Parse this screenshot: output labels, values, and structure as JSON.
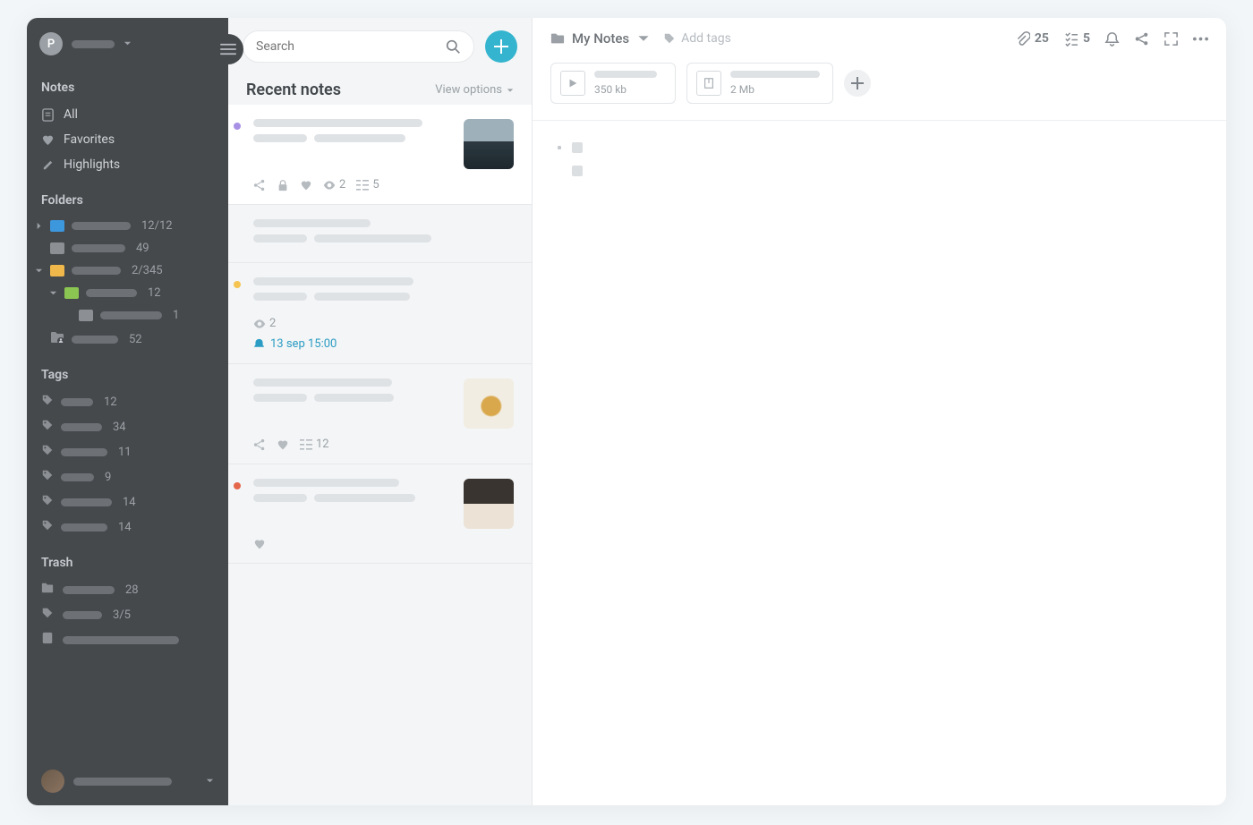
{
  "sidebar": {
    "avatar_initial": "P",
    "sections": {
      "notes_title": "Notes",
      "folders_title": "Folders",
      "tags_title": "Tags",
      "trash_title": "Trash"
    },
    "notes_nav": [
      {
        "icon": "note",
        "label": "All"
      },
      {
        "icon": "heart",
        "label": "Favorites"
      },
      {
        "icon": "pen",
        "label": "Highlights"
      }
    ],
    "folders": [
      {
        "level": 0,
        "expand": "right",
        "color": "blue",
        "count": "12/12"
      },
      {
        "level": 0,
        "expand": "none",
        "color": "grey",
        "count": "49"
      },
      {
        "level": 0,
        "expand": "down",
        "color": "yellow",
        "count": "2/345"
      },
      {
        "level": 1,
        "expand": "down",
        "color": "green",
        "count": "12"
      },
      {
        "level": 2,
        "expand": "none",
        "color": "grey",
        "count": "1"
      },
      {
        "level": 0,
        "expand": "none",
        "color": "shared",
        "count": "52"
      }
    ],
    "tags": [
      {
        "count": "12"
      },
      {
        "count": "34"
      },
      {
        "count": "11"
      },
      {
        "count": "9"
      },
      {
        "count": "14"
      },
      {
        "count": "14"
      }
    ],
    "trash": [
      {
        "icon": "folder",
        "count": "28"
      },
      {
        "icon": "tag",
        "count": "3/5"
      },
      {
        "icon": "note",
        "count": ""
      }
    ]
  },
  "mid": {
    "search_placeholder": "Search",
    "title": "Recent notes",
    "view_options": "View options",
    "notes": [
      {
        "dot": "#a891e5",
        "thumb": "sea",
        "icons": {
          "share": true,
          "lock": true,
          "heart": true,
          "views": "2",
          "tasks": "5"
        }
      },
      {
        "dot": null,
        "thumb": null,
        "icons": {}
      },
      {
        "dot": "#f5c451",
        "thumb": null,
        "icons": {
          "views": "2"
        },
        "reminder": "13 sep 15:00"
      },
      {
        "dot": null,
        "thumb": "dog",
        "icons": {
          "share": true,
          "heart": true,
          "tasks": "12"
        }
      },
      {
        "dot": "#e5674b",
        "thumb": "cafe",
        "icons": {
          "heart": true
        }
      }
    ]
  },
  "main": {
    "breadcrumb": "My Notes",
    "add_tags": "Add tags",
    "attachments_count": "25",
    "tasks_count": "5",
    "attachments": [
      {
        "kind": "video",
        "size": "350 kb"
      },
      {
        "kind": "archive",
        "size": "2 Mb"
      }
    ]
  }
}
